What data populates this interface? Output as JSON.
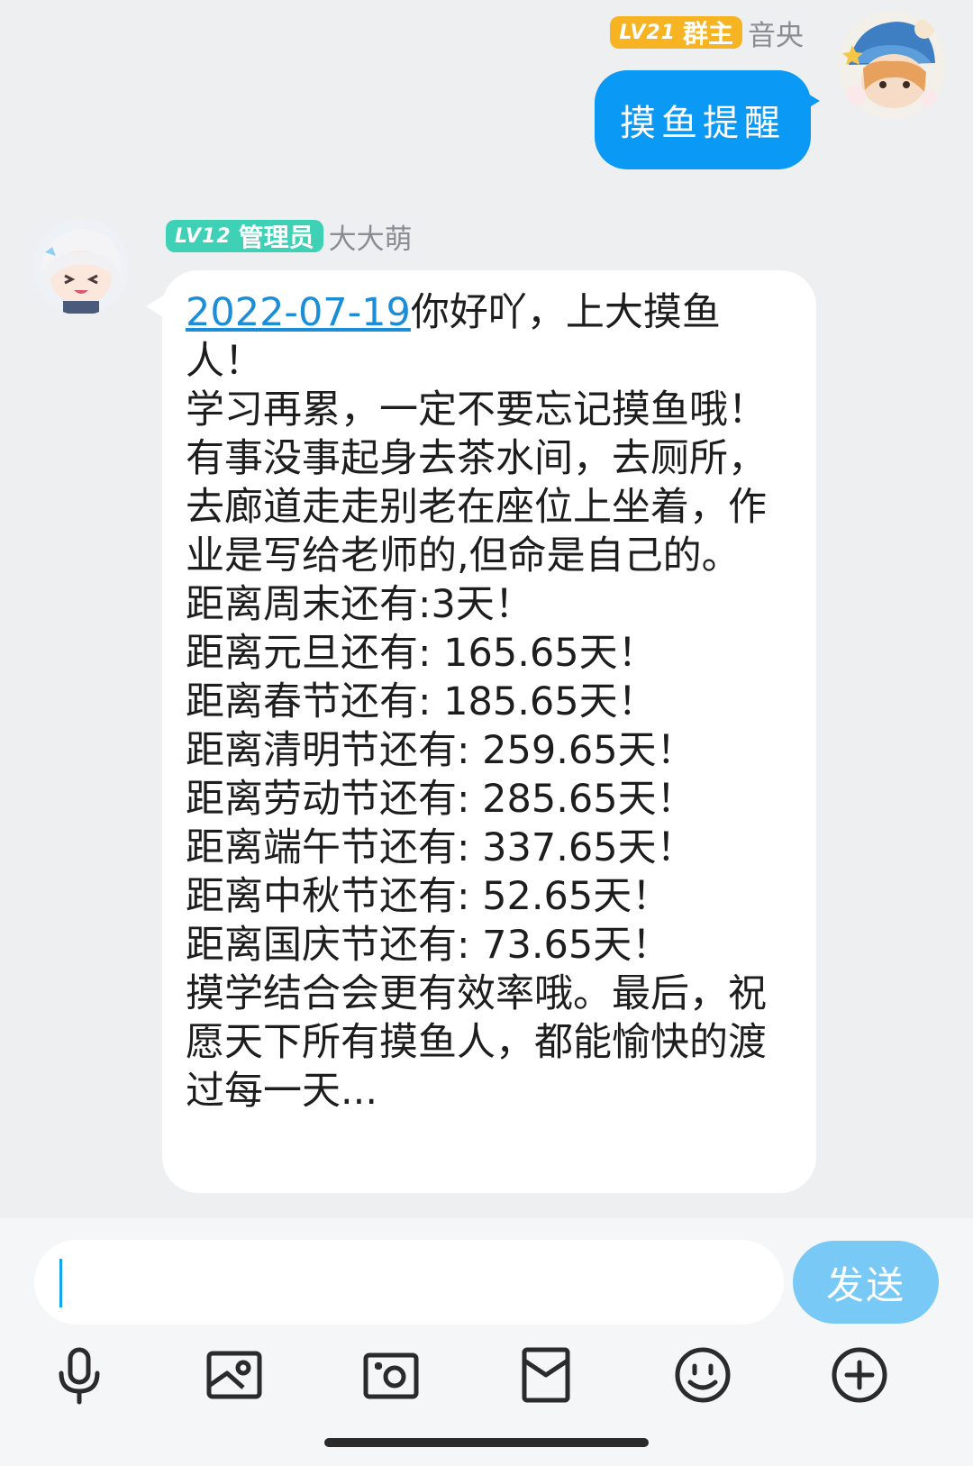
{
  "self_message": {
    "badge_level": "LV21",
    "badge_role": "群主",
    "nickname": "音央",
    "text": "摸鱼提醒"
  },
  "other_message": {
    "badge_level": "LV12",
    "badge_role": "管理员",
    "nickname": "大大萌",
    "link_text": "2022-07-19",
    "body": "你好吖，上大摸鱼人！\n学习再累，一定不要忘记摸鱼哦！有事没事起身去茶水间，去厕所，去廊道走走别老在座位上坐着，作业是写给老师的,但命是自己的。\n距离周末还有:3天！\n距离元旦还有: 165.65天！\n距离春节还有: 185.65天！\n距离清明节还有: 259.65天！\n距离劳动节还有: 285.65天！\n距离端午节还有: 337.65天！\n距离中秋节还有: 52.65天！\n距离国庆节还有: 73.65天！\n摸学结合会更有效率哦。最后，祝愿天下所有摸鱼人，都能愉快的渡过每一天..."
  },
  "input": {
    "placeholder": "",
    "send_label": "发送"
  },
  "toolbar": [
    "microphone-icon",
    "image-icon",
    "camera-icon",
    "red-packet-icon",
    "emoji-icon",
    "plus-icon"
  ],
  "colors": {
    "self_bubble": "#0a99f4",
    "owner_badge": "#f7b422",
    "admin_badge": "#3ed1b5",
    "send_button": "#78c9f6",
    "link": "#1c8ed8"
  }
}
